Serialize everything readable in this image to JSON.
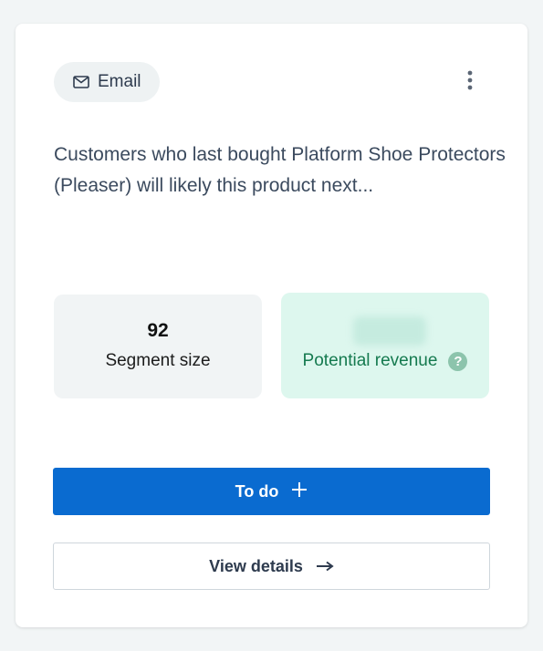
{
  "card": {
    "channel": {
      "label": "Email",
      "icon": "mail-icon"
    },
    "menu_icon": "more-vertical-icon",
    "description": "Customers who last bought Platform Shoe Protectors (Pleaser) will likely this product next...",
    "segment": {
      "value": "92",
      "label": "Segment size"
    },
    "revenue": {
      "label": "Potential revenue",
      "help_icon_text": "?"
    },
    "todo_button": {
      "label": "To do",
      "icon": "plus-icon"
    },
    "details_button": {
      "label": "View details",
      "icon": "arrow-right-icon"
    },
    "colors": {
      "primary": "#0a6bd0",
      "revenue_bg": "#ddf7ee",
      "revenue_text": "#157a4f"
    }
  }
}
